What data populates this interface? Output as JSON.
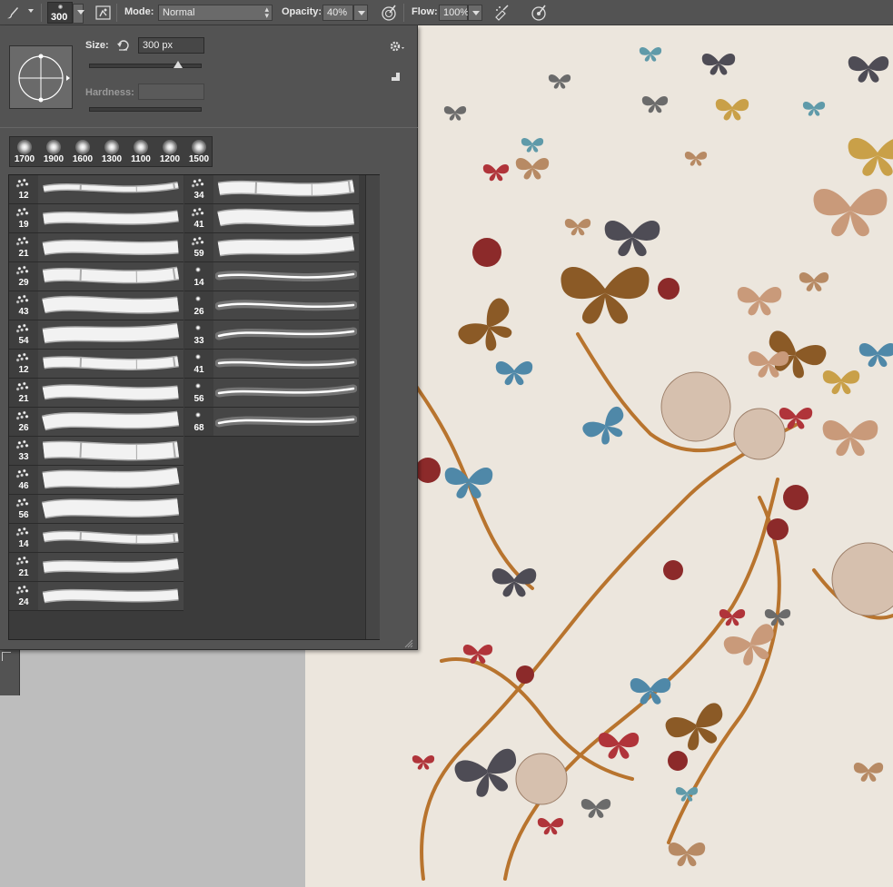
{
  "options_bar": {
    "brush_size": "300",
    "mode_label": "Mode:",
    "mode_value": "Normal",
    "opacity_label": "Opacity:",
    "opacity_value": "40%",
    "flow_label": "Flow:",
    "flow_value": "100%"
  },
  "brush_panel": {
    "size_label": "Size:",
    "size_value": "300 px",
    "size_slider_fraction": 0.82,
    "hardness_label": "Hardness:",
    "presets": [
      "1700",
      "1900",
      "1600",
      "1300",
      "1100",
      "1200",
      "1500"
    ],
    "column_left": [
      "12",
      "19",
      "21",
      "29",
      "43",
      "54",
      "12",
      "21",
      "26",
      "33",
      "46",
      "56",
      "14",
      "21",
      "24"
    ],
    "column_right": [
      "34",
      "41",
      "59",
      "14",
      "26",
      "33",
      "41",
      "56",
      "68"
    ]
  },
  "icons": {
    "tool": "brush-icon",
    "toggle_panel": "brush-panel-toggle-icon",
    "pressure_opacity": "pressure-opacity-icon",
    "airbrush": "airbrush-icon",
    "pressure_size": "pressure-size-icon",
    "settings": "gear-icon",
    "new_preset": "new-preset-icon"
  }
}
